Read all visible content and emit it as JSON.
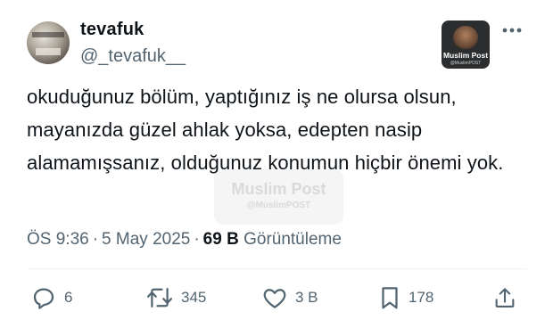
{
  "author": {
    "name": "tevafuk",
    "handle": "@_tevafuk__"
  },
  "tweet": {
    "text": "okuduğunuz bölüm, yaptığınız iş ne olursa olsun, mayanızda güzel ahlak yoksa, edepten nasip alamamışsanız, olduğunuz konumun hiçbir önemi yok."
  },
  "meta": {
    "time": "ÖS 9:36",
    "separator": "·",
    "date": "5 May 2025",
    "views_count": "69 B",
    "views_label": "Görüntüleme"
  },
  "brand": {
    "name": "Muslim Post",
    "handle": "@MuslimPOST"
  },
  "actions": {
    "reply_count": "6",
    "retweet_count": "345",
    "like_count": "3 B",
    "bookmark_count": "178"
  },
  "colors": {
    "text_primary": "#0f1419",
    "text_secondary": "#536471",
    "divider": "#eff3f4"
  },
  "icons": [
    "reply-icon",
    "retweet-icon",
    "like-icon",
    "bookmark-icon",
    "share-icon",
    "more-icon"
  ]
}
